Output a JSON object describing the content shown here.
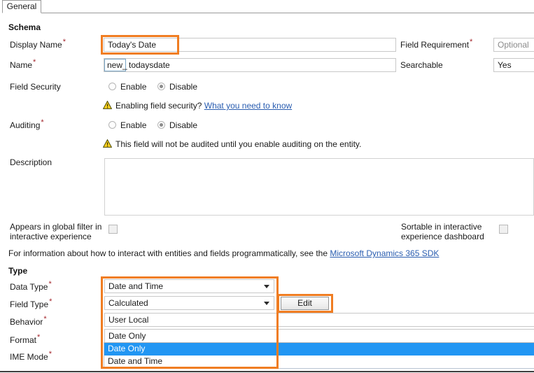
{
  "window": {
    "tab_label": "General"
  },
  "schema": {
    "section_title": "Schema",
    "display_name_label": "Display Name",
    "display_name_value": "Today's Date",
    "field_requirement_label": "Field Requirement",
    "field_requirement_value": "Optional",
    "name_label": "Name",
    "name_prefix": "new_",
    "name_value": "todaysdate",
    "searchable_label": "Searchable",
    "searchable_value": "Yes",
    "field_security_label": "Field Security",
    "field_security_enable": "Enable",
    "field_security_disable": "Disable",
    "field_security_selected": "Disable",
    "field_security_note": "Enabling field security?",
    "field_security_link": "What you need to know",
    "auditing_label": "Auditing",
    "auditing_enable": "Enable",
    "auditing_disable": "Disable",
    "auditing_selected": "Disable",
    "auditing_note": "This field will not be audited until you enable auditing on the entity.",
    "description_label": "Description",
    "description_value": "",
    "global_filter_label_line1": "Appears in global filter in",
    "global_filter_label_line2": "interactive experience",
    "global_filter_checked": false,
    "sortable_label_line1": "Sortable in interactive",
    "sortable_label_line2": "experience dashboard",
    "sortable_checked": false,
    "sdk_note_text": "For information about how to interact with entities and fields programmatically, see the",
    "sdk_link_text": "Microsoft Dynamics 365 SDK"
  },
  "type": {
    "section_title": "Type",
    "data_type_label": "Data Type",
    "data_type_value": "Date and Time",
    "field_type_label": "Field Type",
    "field_type_value": "Calculated",
    "edit_button_label": "Edit",
    "behavior_label": "Behavior",
    "behavior_value": "User Local",
    "format_label": "Format",
    "format_value": "Date Only",
    "ime_mode_label": "IME Mode",
    "format_options": [
      {
        "label": "Date Only",
        "selected": true
      },
      {
        "label": "Date and Time",
        "selected": false
      }
    ]
  },
  "icons": {
    "warning": "warning-triangle-icon",
    "caret": "chevron-down-icon"
  },
  "colors": {
    "highlight_orange": "#f07d22",
    "selection_blue": "#2196f3",
    "required_red": "#a4262c",
    "link_blue": "#2a5db0"
  }
}
